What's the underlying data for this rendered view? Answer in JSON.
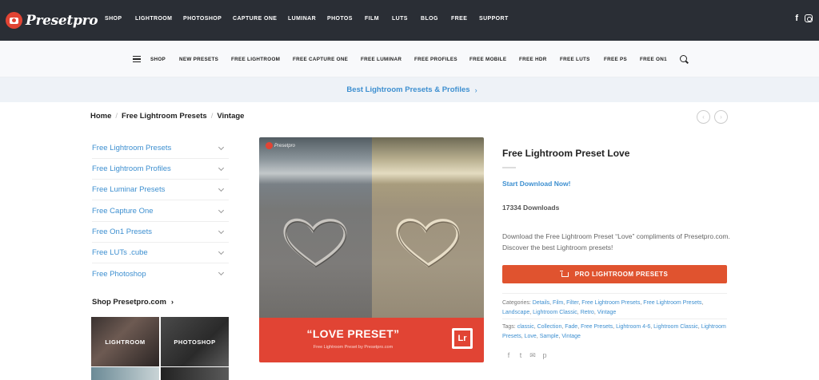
{
  "header": {
    "logo_text": "Presetpro",
    "nav": [
      "SHOP",
      "LIGHTROOM",
      "PHOTOSHOP",
      "CAPTURE ONE",
      "LUMINAR",
      "PHOTOS",
      "FILM",
      "LUTS",
      "BLOG",
      "FREE",
      "SUPPORT"
    ],
    "social": [
      "facebook-icon",
      "instagram-icon"
    ],
    "facebook_glyph": "f"
  },
  "subnav": {
    "items": [
      "SHOP",
      "NEW PRESETS",
      "FREE LIGHTROOM",
      "FREE CAPTURE ONE",
      "FREE LUMINAR",
      "FREE PROFILES",
      "FREE MOBILE",
      "FREE HDR",
      "FREE LUTS",
      "FREE PS",
      "FREE ON1"
    ]
  },
  "promo": {
    "text": "Best Lightroom Presets & Profiles",
    "chevron": "›"
  },
  "breadcrumb": [
    "Home",
    "Free Lightroom Presets",
    "Vintage"
  ],
  "breadcrumb_sep": "/",
  "pager": {
    "prev": "‹",
    "next": "›"
  },
  "sidebar": {
    "items": [
      "Free Lightroom Presets",
      "Free Lightroom Profiles",
      "Free Luminar Presets",
      "Free Capture One",
      "Free On1 Presets",
      "Free LUTs .cube",
      "Free Photoshop"
    ],
    "shop_title": "Shop Presetpro.com",
    "shop_arrow": "›",
    "tiles": [
      "LIGHTROOM",
      "PHOTOSHOP",
      "",
      ""
    ]
  },
  "product_image": {
    "watermark": "Presetpro",
    "banner_title": "“LOVE PRESET”",
    "banner_sub": "Free Lightroom Preset by Presetpro.com",
    "lr_badge": "Lr"
  },
  "product": {
    "title": "Free Lightroom Preset Love",
    "download_link": "Start Download Now!",
    "downloads": "17334 Downloads",
    "description": "Download the Free Lightroom Preset “Love” compliments of Presetpro.com. Discover the best Lightroom presets!",
    "pro_button": "PRO LIGHTROOM PRESETS",
    "categories_label": "Categories:",
    "categories": [
      "Details",
      "Film",
      "Filter",
      "Free Lightroom Presets",
      "Free Lightroom Presets",
      "Landscape",
      "Lightroom Classic",
      "Retro",
      "Vintage"
    ],
    "tags_label": "Tags:",
    "tags": [
      "classic",
      "Collection",
      "Fade",
      "Free Presets",
      "Lightroom 4-6",
      "Lightroom Classic",
      "Lightroom Presets",
      "Love",
      "Sample",
      "Vintage"
    ],
    "share_icons": [
      "facebook-icon",
      "twitter-icon",
      "email-icon",
      "pinterest-icon"
    ],
    "share_glyphs": [
      "f",
      "t",
      "✉",
      "p"
    ]
  },
  "colors": {
    "header_bg": "#2a2e35",
    "accent_red": "#e14434",
    "link_blue": "#3d8fd0",
    "button_orange": "#e0532f"
  }
}
